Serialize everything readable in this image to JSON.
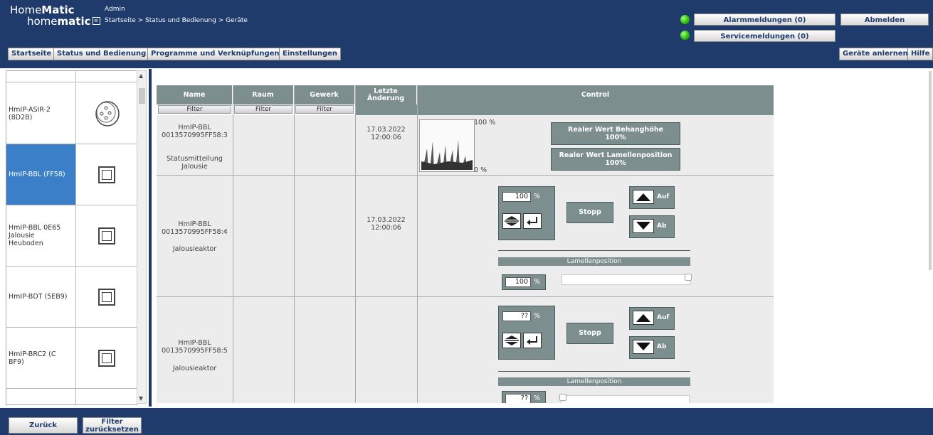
{
  "header": {
    "logo_top_prefix": "Home",
    "logo_top_bold": "Matic",
    "logo_bottom_prefix": "home",
    "logo_bottom_bold": "matic",
    "user": "Admin",
    "breadcrumb": "Startseite > Status und Bedienung > Geräte",
    "alarm_button": "Alarmmeldungen (0)",
    "service_button": "Servicemeldungen (0)",
    "logout_button": "Abmelden",
    "led_color": "#2fbf0f"
  },
  "menu": {
    "items": [
      "Startseite",
      "Status und Bedienung",
      "Programme und Verknüpfungen",
      "Einstellungen"
    ],
    "right_items": [
      "Geräte anlernen",
      "Hilfe"
    ]
  },
  "device_list": [
    {
      "name": "HmIP-ASIR-2\n(8D2B)",
      "icon": "siren-icon",
      "selected": false
    },
    {
      "name": "HmIP-BBL (FF58)",
      "icon": "blind-actuator-icon",
      "selected": true
    },
    {
      "name": "HmIP-BBL 0E65\nJalousie\nHeuboden",
      "icon": "blind-actuator-icon",
      "selected": false
    },
    {
      "name": "HmIP-BDT (5EB9)",
      "icon": "dimmer-icon",
      "selected": false
    },
    {
      "name": "HmIP-BRC2 (C\nBF9)",
      "icon": "remote-icon",
      "selected": false
    }
  ],
  "table": {
    "headers": [
      "Name",
      "Raum",
      "Gewerk",
      "Letzte\nÄnderung",
      "Control"
    ],
    "filter_label": "Filter",
    "rows": [
      {
        "name": "HmIP-BBL\n0013570995FF58:3",
        "type": "Statusmitteilung\nJalousie",
        "date": "17.03.2022\n12:00:06",
        "image_top": "100 %",
        "image_bottom": "0 %",
        "btn1": "Realer Wert Behanghöhe\n100%",
        "btn2": "Realer Wert Lamellenposition\n100%"
      },
      {
        "name": "HmIP-BBL\n0013570995FF58:4",
        "type": "Jalousieaktor",
        "date": "17.03.2022\n12:00:06",
        "value": "100",
        "lamellen_value": "100"
      },
      {
        "name": "HmIP-BBL\n0013570995FF58:5",
        "type": "Jalousieaktor",
        "value": "??",
        "lamellen_value": "??"
      }
    ],
    "percent_sign": "%",
    "stop_label": "Stopp",
    "up_label": "Auf",
    "down_label": "Ab",
    "lamellen_label": "Lamellenposition"
  },
  "footer": {
    "back_button": "Zurück",
    "reset_filter_button": "Filter\nzurücksetzen"
  }
}
